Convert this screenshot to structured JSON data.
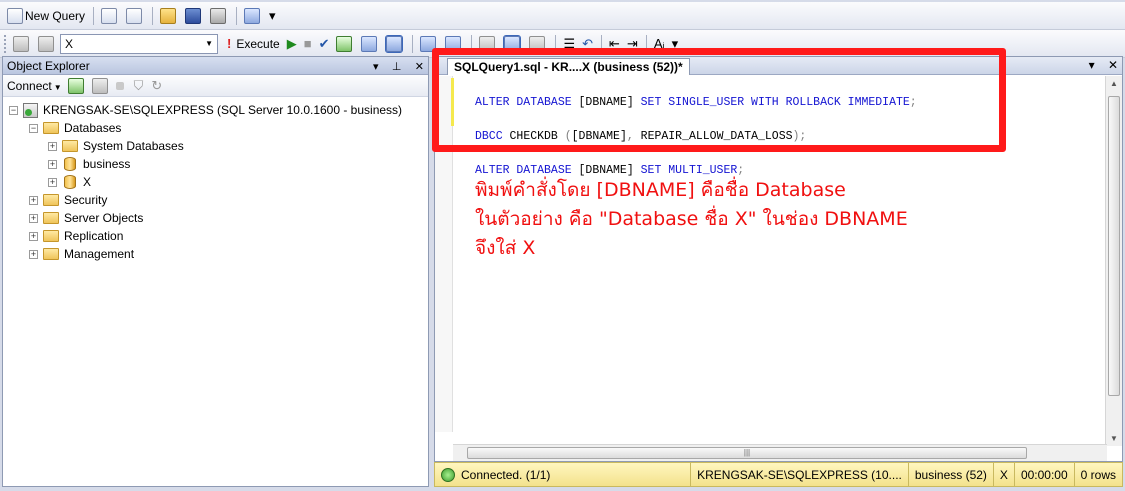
{
  "toolbar1": {
    "new_query_label": "New Query"
  },
  "toolbar2": {
    "database_selected": "X",
    "execute_label": "Execute"
  },
  "object_explorer": {
    "title": "Object Explorer",
    "connect_label": "Connect",
    "server_node": "KRENGSAK-SE\\SQLEXPRESS (SQL Server 10.0.1600 - business)",
    "databases_label": "Databases",
    "system_databases_label": "System Databases",
    "db_business_label": "business",
    "db_x_label": "X",
    "security_label": "Security",
    "server_objects_label": "Server Objects",
    "replication_label": "Replication",
    "management_label": "Management"
  },
  "editor": {
    "tab_title": "SQLQuery1.sql - KR....X (business (52))*",
    "code": {
      "line1": {
        "kw1": "ALTER DATABASE",
        "t1": " [DBNAME] ",
        "kw2": "SET SINGLE_USER WITH ROLLBACK IMMEDIATE",
        "t2": ";"
      },
      "line2": {
        "kw1": "DBCC",
        "t1": " CHECKDB ",
        "p1": "(",
        "t2": "[DBNAME]",
        "p2": ", ",
        "t3": "REPAIR_ALLOW_DATA_LOSS",
        "p3": ");"
      },
      "line3": {
        "kw1": "ALTER DATABASE",
        "t1": " [DBNAME] ",
        "kw2": "SET MULTI_USER",
        "t2": ";"
      }
    }
  },
  "annotation": {
    "line1": "พิมพ์คำสั่งโดย [DBNAME] คือชื่อ Database",
    "line2": "ในตัวอย่าง คือ \"Database ชื่อ X\" ในช่อง DBNAME",
    "line3": "จึงใส่ X",
    "color": "#f01010"
  },
  "status": {
    "connected": "Connected. (1/1)",
    "server": "KRENGSAK-SE\\SQLEXPRESS (10....",
    "database": "business (52)",
    "db": "X",
    "time": "00:00:00",
    "rows": "0 rows"
  }
}
